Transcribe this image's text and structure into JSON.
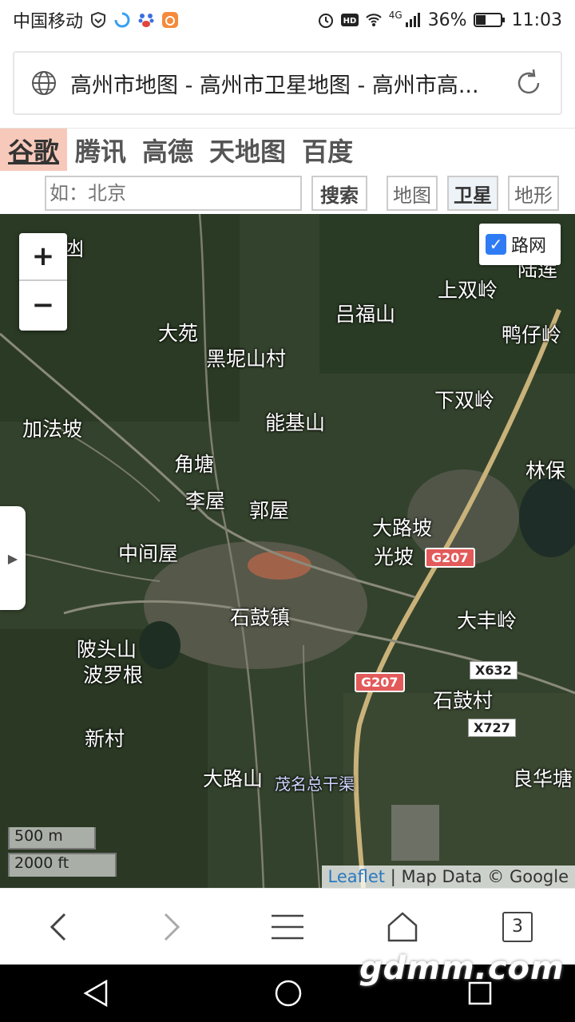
{
  "status_bar": {
    "carrier": "中国移动",
    "network": "4G",
    "battery": "36%",
    "time": "11:03",
    "icons": [
      "shield-icon",
      "loading-icon",
      "baidu-icon",
      "app-icon",
      "alarm-icon",
      "hd-icon",
      "wifi-icon",
      "signal-icon",
      "battery-icon"
    ]
  },
  "browser": {
    "page_title": "高州市地图 - 高州市卫星地图 - 高州市高...",
    "tab_count": "3"
  },
  "providers": [
    {
      "label": "谷歌",
      "active": true
    },
    {
      "label": "腾讯",
      "active": false
    },
    {
      "label": "高德",
      "active": false
    },
    {
      "label": "天地图",
      "active": false
    },
    {
      "label": "百度",
      "active": false
    }
  ],
  "search": {
    "placeholder": "如：北京",
    "button": "搜索"
  },
  "map_types": {
    "map": "地图",
    "satellite": "卫星",
    "terrain": "地形",
    "selected": "卫星"
  },
  "map": {
    "road_layer_label": "路网",
    "road_layer_checked": true,
    "zoom_in": "+",
    "zoom_out": "−",
    "scale_metric": "500 m",
    "scale_imperial": "2000 ft",
    "attribution_link": "Leaflet",
    "attribution_text": " | Map Data © Google",
    "places": [
      {
        "name": "凼"
      },
      {
        "name": "吕福山"
      },
      {
        "name": "上双岭"
      },
      {
        "name": "陆莲"
      },
      {
        "name": "大苑"
      },
      {
        "name": "黑坭山村"
      },
      {
        "name": "鸭仔岭"
      },
      {
        "name": "下双岭"
      },
      {
        "name": "加法坡"
      },
      {
        "name": "能基山"
      },
      {
        "name": "角塘"
      },
      {
        "name": "林保"
      },
      {
        "name": "李屋"
      },
      {
        "name": "郭屋"
      },
      {
        "name": "大路坡"
      },
      {
        "name": "光坡"
      },
      {
        "name": "中间屋"
      },
      {
        "name": "石鼓镇"
      },
      {
        "name": "大丰岭"
      },
      {
        "name": "陂头山"
      },
      {
        "name": "波罗根"
      },
      {
        "name": "石鼓村"
      },
      {
        "name": "新村"
      },
      {
        "name": "大路山"
      },
      {
        "name": "茂名总干渠"
      },
      {
        "name": "良华塘"
      }
    ],
    "road_shields": [
      "G207",
      "G207",
      "X632",
      "X727"
    ]
  },
  "watermark": "gdmm.com"
}
